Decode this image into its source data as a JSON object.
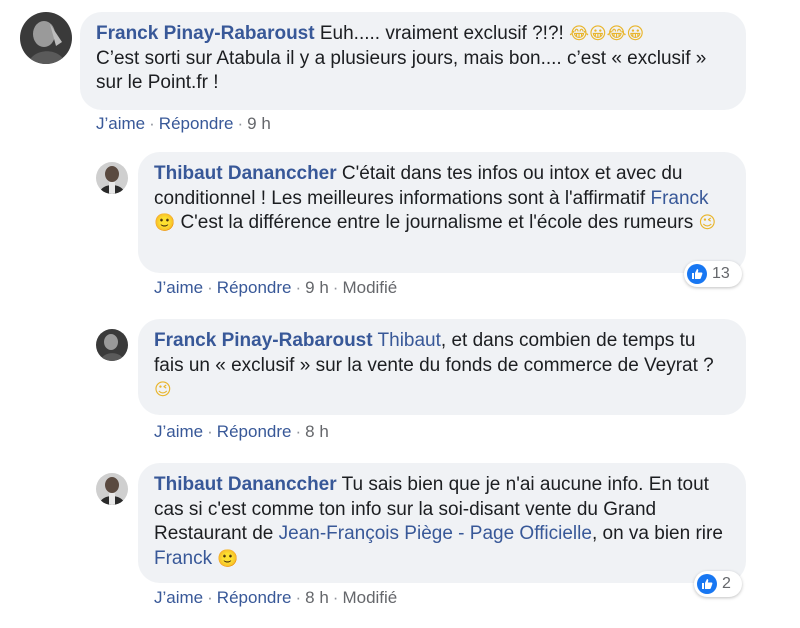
{
  "comments": [
    {
      "author": "Franck Pinay-Rabaroust",
      "text_1": " Euh..... vraiment exclusif ?!?! ",
      "emoji_1": "😂😀😂😀",
      "text_2": "C’est sorti sur Atabula il y a plusieurs jours, mais bon.... c’est « exclusif » sur le Point.fr !",
      "actions": {
        "like": "J’aime",
        "reply": "Répondre",
        "time": "9 h"
      }
    },
    {
      "author": "Thibaut Dananccher",
      "text_1": " C'était dans tes infos ou intox et avec du conditionnel ! Les meilleures informations sont à l'affirmatif ",
      "mention": "Franck",
      "emoji_1": "🙂",
      "text_2": " C'est la différence entre le journalisme et l'école des rumeurs ",
      "emoji_2": "😉",
      "reaction_count": "13",
      "actions": {
        "like": "J’aime",
        "reply": "Répondre",
        "time": "9 h",
        "edited": "Modifié"
      }
    },
    {
      "author": "Franck Pinay-Rabaroust",
      "mention": "Thibaut",
      "text_1": ", et dans combien de temps tu fais un « exclusif » sur la vente du fonds de commerce de Veyrat ? ",
      "emoji_1": "😉",
      "actions": {
        "like": "J’aime",
        "reply": "Répondre",
        "time": "8 h"
      }
    },
    {
      "author": "Thibaut Dananccher",
      "text_1": " Tu sais bien que je n'ai aucune info. En tout cas si c'est comme ton info sur la soi-disant vente du Grand Restaurant de ",
      "mention": "Jean-François Piège - Page Officielle",
      "text_2": ", on va bien rire ",
      "mention_2": "Franck",
      "emoji_1": "🙂",
      "reaction_count": "2",
      "actions": {
        "like": "J’aime",
        "reply": "Répondre",
        "time": "8 h",
        "edited": "Modifié"
      }
    }
  ]
}
